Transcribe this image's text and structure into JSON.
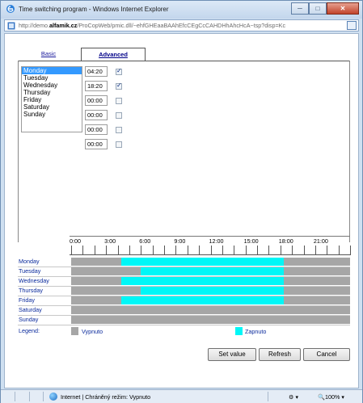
{
  "window": {
    "title": "Time switching program - Windows Internet Explorer",
    "url_prefix": "http://demo.",
    "url_host": "alfamik.cz",
    "url_rest": "/ProCopWeb/pmic.dll/~ehfGHEaaBAAhEfcCEgCcCAHDHhAhcHcA~tsp?disp=Kc"
  },
  "tabs": {
    "basic": "Basic",
    "advanced": "Advanced"
  },
  "days": [
    "Monday",
    "Tuesday",
    "Wednesday",
    "Thursday",
    "Friday",
    "Saturday",
    "Sunday"
  ],
  "selected_day": "Monday",
  "times": [
    {
      "value": "04:20",
      "checked": true
    },
    {
      "value": "18:20",
      "checked": true
    },
    {
      "value": "00:00",
      "checked": false
    },
    {
      "value": "00:00",
      "checked": false
    },
    {
      "value": "00:00",
      "checked": false
    },
    {
      "value": "00:00",
      "checked": false
    }
  ],
  "schedule": {
    "hour_labels": [
      "0:00",
      "3:00",
      "6:00",
      "9:00",
      "12:00",
      "15:00",
      "18:00",
      "21:00"
    ],
    "rows": [
      {
        "day": "Monday",
        "on": [
          [
            4.33,
            18.33
          ]
        ]
      },
      {
        "day": "Tuesday",
        "on": [
          [
            6.0,
            18.33
          ]
        ]
      },
      {
        "day": "Wednesday",
        "on": [
          [
            4.33,
            18.33
          ]
        ]
      },
      {
        "day": "Thursday",
        "on": [
          [
            6.0,
            18.33
          ]
        ]
      },
      {
        "day": "Friday",
        "on": [
          [
            4.33,
            18.33
          ]
        ]
      },
      {
        "day": "Saturday",
        "on": []
      },
      {
        "day": "Sunday",
        "on": []
      }
    ],
    "legend_label": "Legend:",
    "legend_off": "Vypnuto",
    "legend_on": "Zapnuto",
    "off_color": "#a6a6a6",
    "on_color": "#00f7f7"
  },
  "buttons": {
    "set_value": "Set value",
    "refresh": "Refresh",
    "cancel": "Cancel"
  },
  "status": {
    "zone": "Internet | Chráněný režim: Vypnuto",
    "zoom": "100%"
  }
}
